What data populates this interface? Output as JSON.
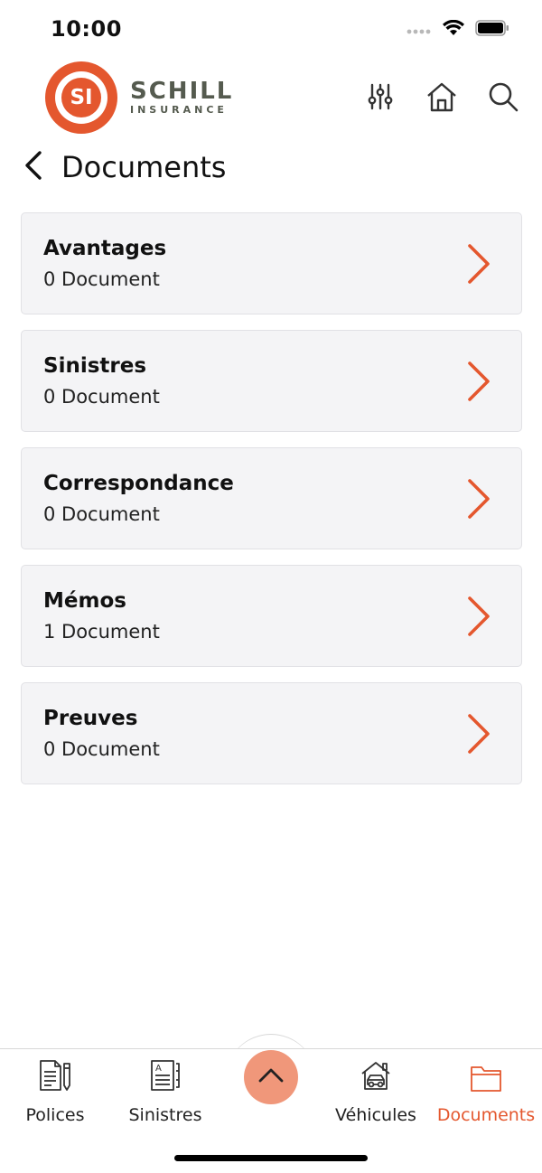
{
  "status_bar": {
    "time": "10:00"
  },
  "brand": {
    "initials": "SI",
    "name": "SCHILL",
    "sub": "INSURANCE",
    "accent": "#e4572e",
    "text_color": "#555b4f"
  },
  "header": {
    "filter_icon": "sliders-icon",
    "home_icon": "home-icon",
    "search_icon": "search-icon"
  },
  "page": {
    "title": "Documents"
  },
  "documents": [
    {
      "name": "Avantages",
      "count": "0 Document"
    },
    {
      "name": "Sinistres",
      "count": "0 Document"
    },
    {
      "name": "Correspondance",
      "count": "0 Document"
    },
    {
      "name": "Mémos",
      "count": "1 Document"
    },
    {
      "name": "Preuves",
      "count": "0 Document"
    }
  ],
  "tabs": [
    {
      "label": "Polices",
      "icon": "policy-document-icon",
      "active": false
    },
    {
      "label": "Sinistres",
      "icon": "claim-document-icon",
      "active": false
    },
    {
      "label": "Véhicules",
      "icon": "car-garage-icon",
      "active": false
    },
    {
      "label": "Documents",
      "icon": "folder-icon",
      "active": true
    }
  ],
  "fab": {
    "icon": "chevron-up-icon",
    "color": "#f0977a"
  }
}
